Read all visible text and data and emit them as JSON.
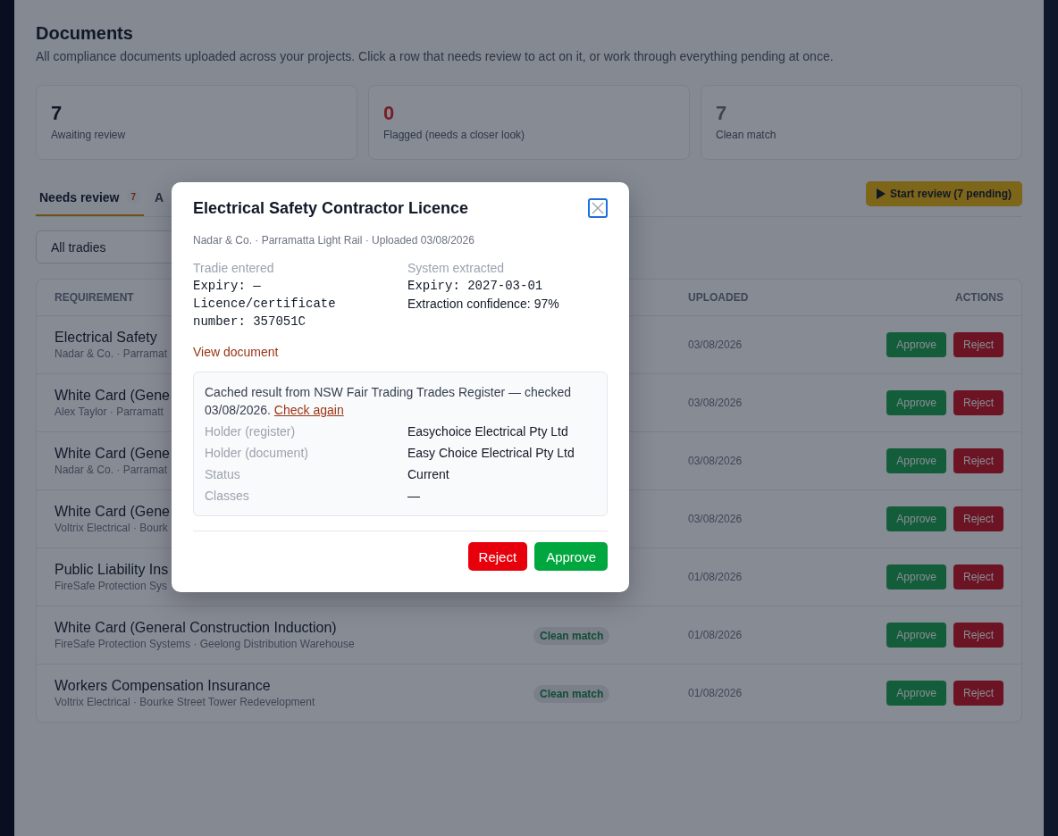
{
  "page": {
    "title": "Documents",
    "subtitle": "All compliance documents uploaded across your projects. Click a row that needs review to act on it, or work through everything pending at once."
  },
  "stats": [
    {
      "kind": "plain",
      "value": "7",
      "label": "Awaiting review"
    },
    {
      "kind": "alert",
      "value": "0",
      "label": "Flagged (needs a closer look)"
    },
    {
      "kind": "muted",
      "value": "7",
      "label": "Clean match"
    }
  ],
  "tabs": [
    {
      "label": "Needs review",
      "count": "7",
      "selected": true
    },
    {
      "label": "A",
      "selected": false
    }
  ],
  "start_review_button": {
    "label": "Start review (7 pending)"
  },
  "filter": {
    "value": "All tradies"
  },
  "table": {
    "columns": [
      "REQUIREMENT",
      "UPLOADED",
      "ACTIONS"
    ],
    "rows": [
      {
        "requirement": "Electrical Safety",
        "detail": "Nadar & Co. · Parramat",
        "uploaded": "03/08/2026",
        "actions": [
          "Approve",
          "Reject"
        ]
      },
      {
        "requirement": "White Card (Gene",
        "detail": "Alex Taylor · Parramatt",
        "uploaded": "03/08/2026",
        "actions": [
          "Approve",
          "Reject"
        ]
      },
      {
        "requirement": "White Card (Gene",
        "detail": "Nadar & Co. · Parramat",
        "uploaded": "03/08/2026",
        "actions": [
          "Approve",
          "Reject"
        ]
      },
      {
        "requirement": "White Card (Gene",
        "detail": "Voltrix Electrical · Bourk",
        "uploaded": "03/08/2026",
        "actions": [
          "Approve",
          "Reject"
        ]
      },
      {
        "requirement": "Public Liability Ins",
        "detail": "FireSafe Protection Sys",
        "uploaded": "01/08/2026",
        "actions": [
          "Approve",
          "Reject"
        ]
      },
      {
        "requirement": "White Card (General Construction Induction)",
        "detail": "FireSafe Protection Systems · Geelong Distribution Warehouse",
        "status": "Clean match",
        "uploaded": "01/08/2026",
        "actions": [
          "Approve",
          "Reject"
        ]
      },
      {
        "requirement": "Workers Compensation Insurance",
        "detail": "Voltrix Electrical · Bourke Street Tower Redevelopment",
        "status": "Clean match",
        "uploaded": "01/08/2026",
        "actions": [
          "Approve",
          "Reject"
        ]
      }
    ]
  },
  "dialog": {
    "title": "Electrical Safety Contractor Licence",
    "meta": "Nadar & Co. · Parramatta Light Rail · Uploaded 03/08/2026",
    "columns": [
      {
        "heading": "Tradie entered",
        "lines": [
          {
            "kind": "mono",
            "text": "Expiry: —"
          },
          {
            "kind": "mono",
            "text": "Licence/certificate number: 357051C"
          }
        ]
      },
      {
        "heading": "System extracted",
        "lines": [
          {
            "kind": "mono",
            "text": "Expiry: 2027-03-01"
          },
          {
            "kind": "text",
            "text": "Extraction confidence: 97%"
          }
        ]
      }
    ],
    "view_link": "View document",
    "register": {
      "note": "Cached result from NSW Fair Trading Trades Register — checked 03/08/2026.",
      "link": "Check again",
      "fields": [
        {
          "label": "Holder (register)",
          "value": "Easychoice Electrical Pty Ltd"
        },
        {
          "label": "Holder (document)",
          "value": "Easy Choice Electrical Pty Ltd"
        },
        {
          "label": "Status",
          "value": "Current"
        },
        {
          "label": "Classes",
          "value": "—"
        }
      ]
    },
    "buttons": [
      {
        "label": "Reject",
        "kind": "reject"
      },
      {
        "label": "Approve",
        "kind": "approve"
      }
    ]
  }
}
